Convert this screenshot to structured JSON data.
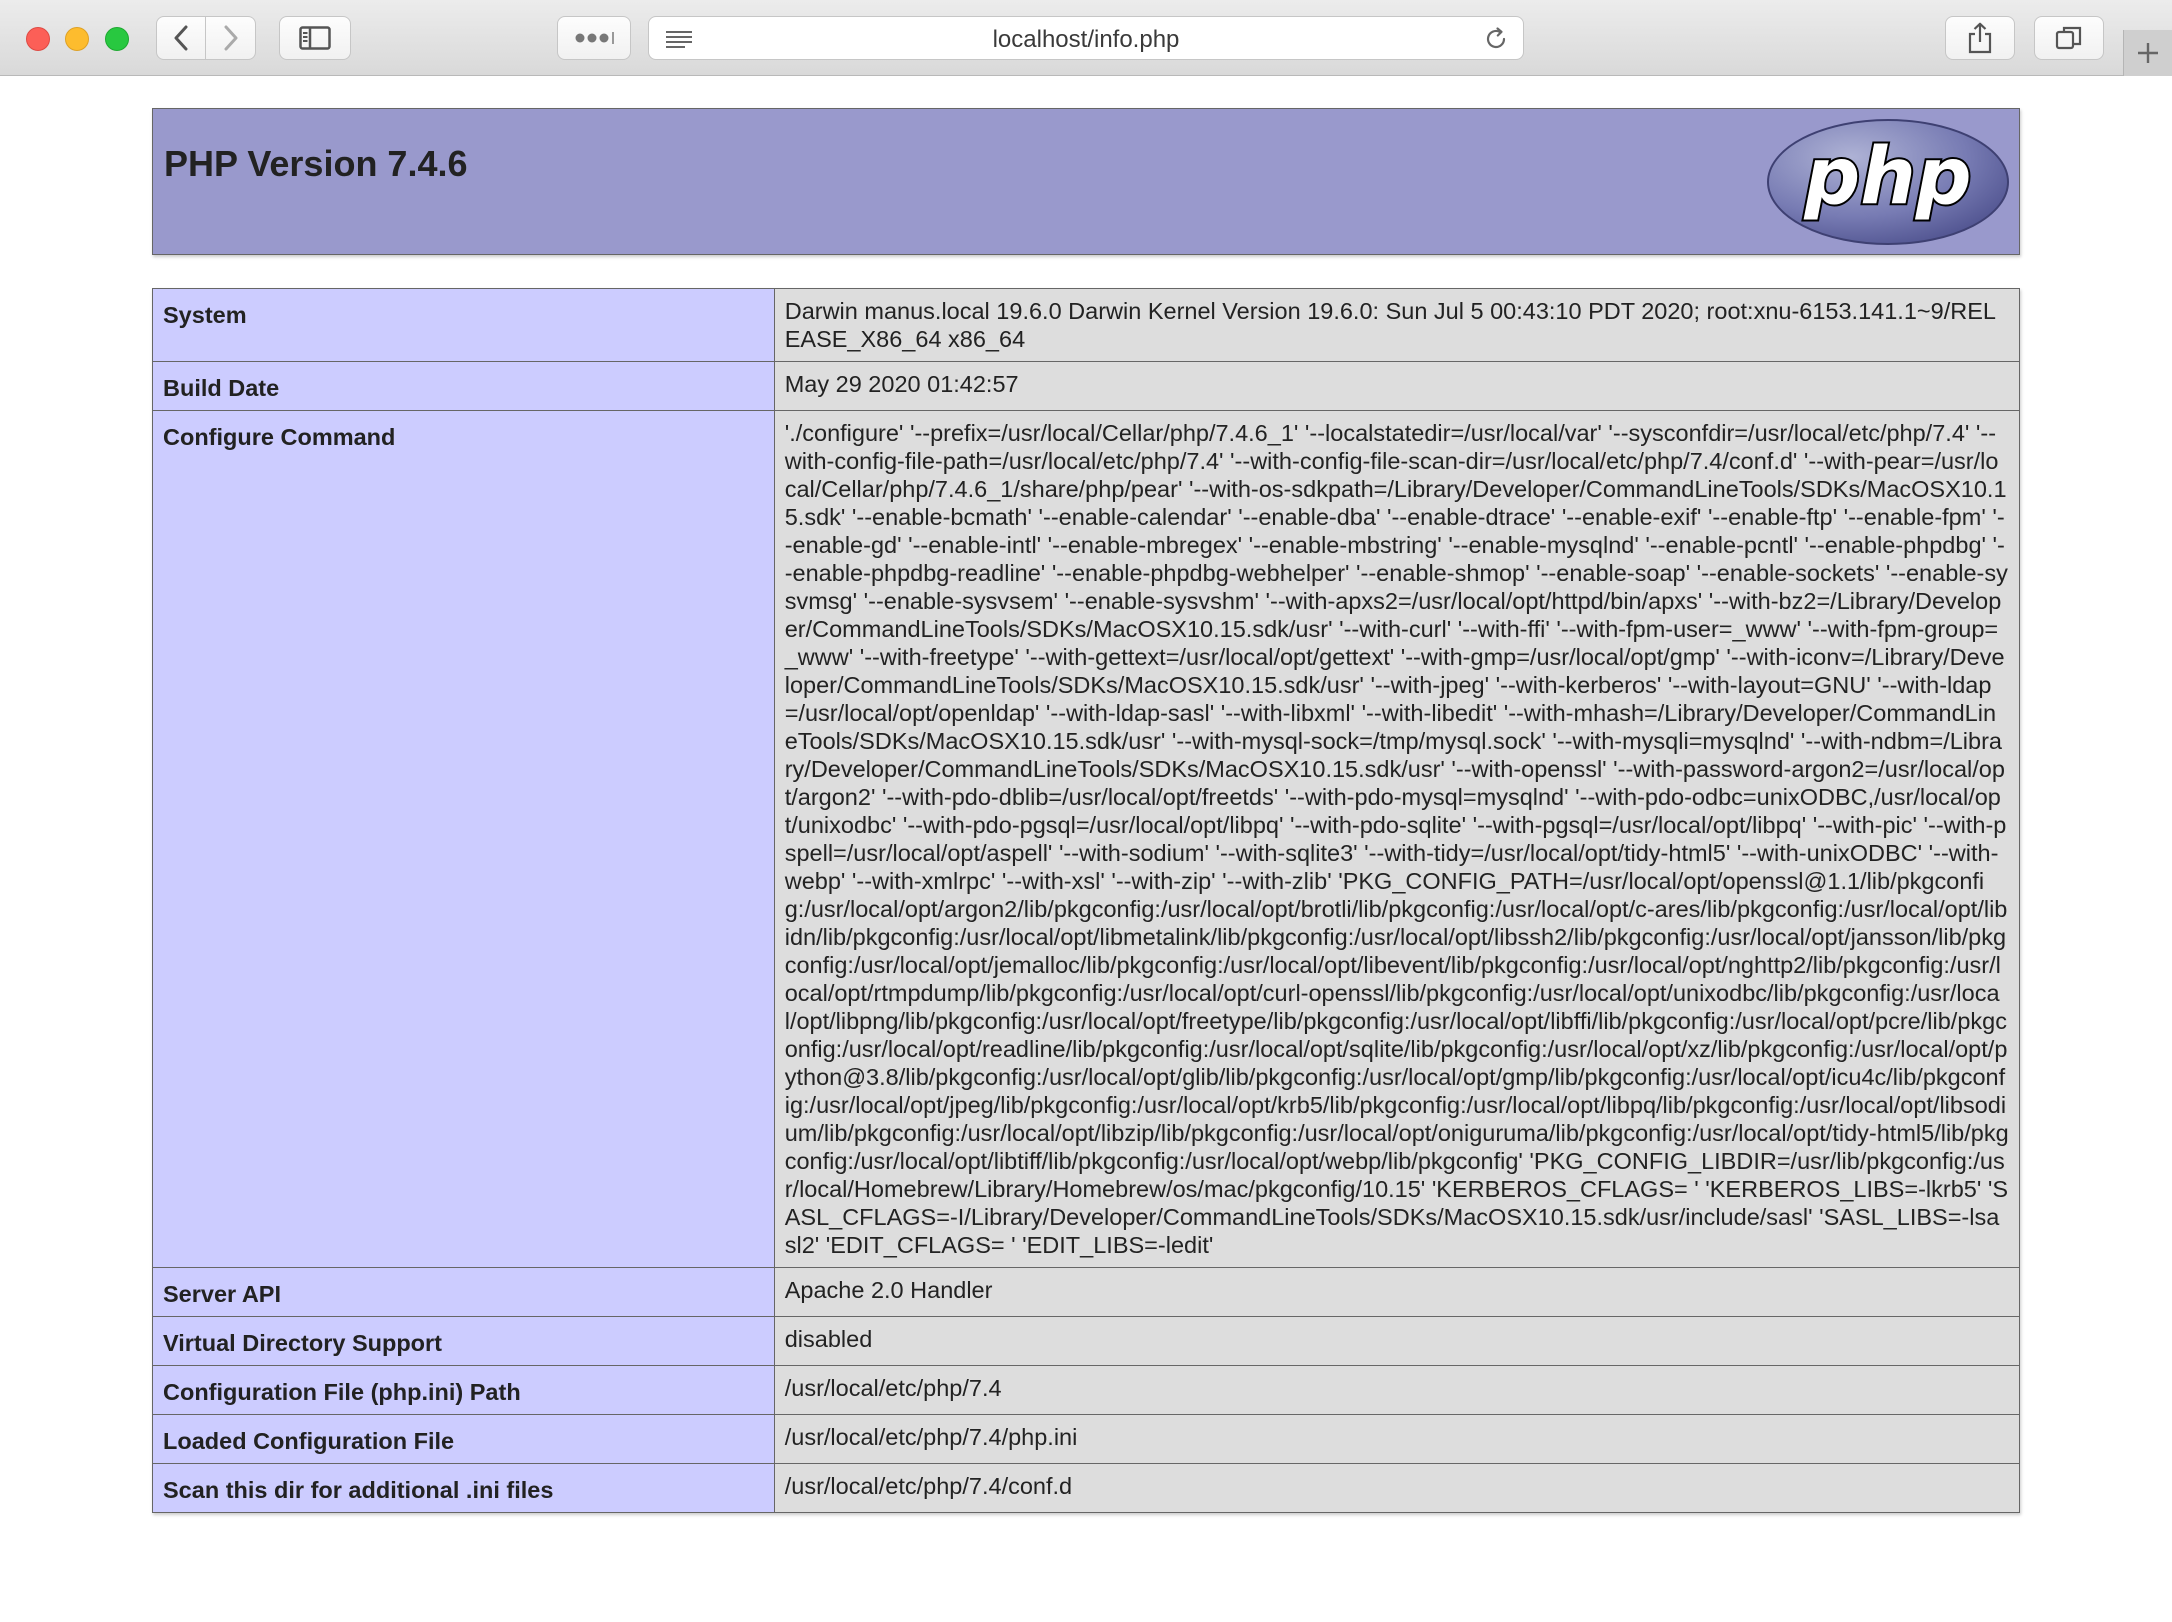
{
  "browser": {
    "url": "localhost/info.php"
  },
  "header": {
    "title": "PHP Version 7.4.6",
    "logo_text": "php"
  },
  "rows": [
    {
      "key": "System",
      "value": "Darwin manus.local 19.6.0 Darwin Kernel Version 19.6.0: Sun Jul 5 00:43:10 PDT 2020; root:xnu-6153.141.1~9/RELEASE_X86_64 x86_64"
    },
    {
      "key": "Build Date",
      "value": "May 29 2020 01:42:57"
    },
    {
      "key": "Configure Command",
      "value": "'./configure' '--prefix=/usr/local/Cellar/php/7.4.6_1' '--localstatedir=/usr/local/var' '--sysconfdir=/usr/local/etc/php/7.4' '--with-config-file-path=/usr/local/etc/php/7.4' '--with-config-file-scan-dir=/usr/local/etc/php/7.4/conf.d' '--with-pear=/usr/local/Cellar/php/7.4.6_1/share/php/pear' '--with-os-sdkpath=/Library/Developer/CommandLineTools/SDKs/MacOSX10.15.sdk' '--enable-bcmath' '--enable-calendar' '--enable-dba' '--enable-dtrace' '--enable-exif' '--enable-ftp' '--enable-fpm' '--enable-gd' '--enable-intl' '--enable-mbregex' '--enable-mbstring' '--enable-mysqlnd' '--enable-pcntl' '--enable-phpdbg' '--enable-phpdbg-readline' '--enable-phpdbg-webhelper' '--enable-shmop' '--enable-soap' '--enable-sockets' '--enable-sysvmsg' '--enable-sysvsem' '--enable-sysvshm' '--with-apxs2=/usr/local/opt/httpd/bin/apxs' '--with-bz2=/Library/Developer/CommandLineTools/SDKs/MacOSX10.15.sdk/usr' '--with-curl' '--with-ffi' '--with-fpm-user=_www' '--with-fpm-group=_www' '--with-freetype' '--with-gettext=/usr/local/opt/gettext' '--with-gmp=/usr/local/opt/gmp' '--with-iconv=/Library/Developer/CommandLineTools/SDKs/MacOSX10.15.sdk/usr' '--with-jpeg' '--with-kerberos' '--with-layout=GNU' '--with-ldap=/usr/local/opt/openldap' '--with-ldap-sasl' '--with-libxml' '--with-libedit' '--with-mhash=/Library/Developer/CommandLineTools/SDKs/MacOSX10.15.sdk/usr' '--with-mysql-sock=/tmp/mysql.sock' '--with-mysqli=mysqlnd' '--with-ndbm=/Library/Developer/CommandLineTools/SDKs/MacOSX10.15.sdk/usr' '--with-openssl' '--with-password-argon2=/usr/local/opt/argon2' '--with-pdo-dblib=/usr/local/opt/freetds' '--with-pdo-mysql=mysqlnd' '--with-pdo-odbc=unixODBC,/usr/local/opt/unixodbc' '--with-pdo-pgsql=/usr/local/opt/libpq' '--with-pdo-sqlite' '--with-pgsql=/usr/local/opt/libpq' '--with-pic' '--with-pspell=/usr/local/opt/aspell' '--with-sodium' '--with-sqlite3' '--with-tidy=/usr/local/opt/tidy-html5' '--with-unixODBC' '--with-webp' '--with-xmlrpc' '--with-xsl' '--with-zip' '--with-zlib' 'PKG_CONFIG_PATH=/usr/local/opt/openssl@1.1/lib/pkgconfig:/usr/local/opt/argon2/lib/pkgconfig:/usr/local/opt/brotli/lib/pkgconfig:/usr/local/opt/c-ares/lib/pkgconfig:/usr/local/opt/libidn/lib/pkgconfig:/usr/local/opt/libmetalink/lib/pkgconfig:/usr/local/opt/libssh2/lib/pkgconfig:/usr/local/opt/jansson/lib/pkgconfig:/usr/local/opt/jemalloc/lib/pkgconfig:/usr/local/opt/libevent/lib/pkgconfig:/usr/local/opt/nghttp2/lib/pkgconfig:/usr/local/opt/rtmpdump/lib/pkgconfig:/usr/local/opt/curl-openssl/lib/pkgconfig:/usr/local/opt/unixodbc/lib/pkgconfig:/usr/local/opt/libpng/lib/pkgconfig:/usr/local/opt/freetype/lib/pkgconfig:/usr/local/opt/libffi/lib/pkgconfig:/usr/local/opt/pcre/lib/pkgconfig:/usr/local/opt/readline/lib/pkgconfig:/usr/local/opt/sqlite/lib/pkgconfig:/usr/local/opt/xz/lib/pkgconfig:/usr/local/opt/python@3.8/lib/pkgconfig:/usr/local/opt/glib/lib/pkgconfig:/usr/local/opt/gmp/lib/pkgconfig:/usr/local/opt/icu4c/lib/pkgconfig:/usr/local/opt/jpeg/lib/pkgconfig:/usr/local/opt/krb5/lib/pkgconfig:/usr/local/opt/libpq/lib/pkgconfig:/usr/local/opt/libsodium/lib/pkgconfig:/usr/local/opt/libzip/lib/pkgconfig:/usr/local/opt/oniguruma/lib/pkgconfig:/usr/local/opt/tidy-html5/lib/pkgconfig:/usr/local/opt/libtiff/lib/pkgconfig:/usr/local/opt/webp/lib/pkgconfig' 'PKG_CONFIG_LIBDIR=/usr/lib/pkgconfig:/usr/local/Homebrew/Library/Homebrew/os/mac/pkgconfig/10.15' 'KERBEROS_CFLAGS= ' 'KERBEROS_LIBS=-lkrb5' 'SASL_CFLAGS=-I/Library/Developer/CommandLineTools/SDKs/MacOSX10.15.sdk/usr/include/sasl' 'SASL_LIBS=-lsasl2' 'EDIT_CFLAGS= ' 'EDIT_LIBS=-ledit'"
    },
    {
      "key": "Server API",
      "value": "Apache 2.0 Handler"
    },
    {
      "key": "Virtual Directory Support",
      "value": "disabled"
    },
    {
      "key": "Configuration File (php.ini) Path",
      "value": "/usr/local/etc/php/7.4"
    },
    {
      "key": "Loaded Configuration File",
      "value": "/usr/local/etc/php/7.4/php.ini"
    },
    {
      "key": "Scan this dir for additional .ini files",
      "value": "/usr/local/etc/php/7.4/conf.d"
    }
  ]
}
